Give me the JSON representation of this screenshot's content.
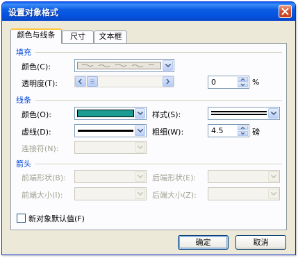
{
  "window": {
    "title": "设置对象格式"
  },
  "tabs": [
    {
      "label": "颜色与线条"
    },
    {
      "label": "尺寸"
    },
    {
      "label": "文本框"
    }
  ],
  "fill": {
    "group_label": "填充",
    "color_label": "颜色(C):",
    "transparency_label": "透明度(T):",
    "transparency_value": "0",
    "transparency_unit": "%",
    "transparency_level": 0
  },
  "line": {
    "group_label": "线条",
    "color_label": "颜色(O):",
    "color_value": "#1a9c92",
    "style_label": "样式(S):",
    "dash_label": "虚线(D):",
    "weight_label": "粗细(W):",
    "weight_value": "4.5",
    "weight_unit": "磅",
    "connector_label": "连接符(N):"
  },
  "arrows": {
    "group_label": "箭头",
    "begin_style_label": "前端形状(B):",
    "end_style_label": "后端形状(E):",
    "begin_size_label": "前端大小(I):",
    "end_size_label": "后端大小(Z):"
  },
  "default_checkbox": {
    "label": "新对象默认值(F)"
  },
  "buttons": {
    "ok": "确定",
    "cancel": "取消"
  },
  "colors": {
    "titlebar": "#0a5bf1",
    "group_label": "#0046d5",
    "line_color": "#1a9c92"
  }
}
